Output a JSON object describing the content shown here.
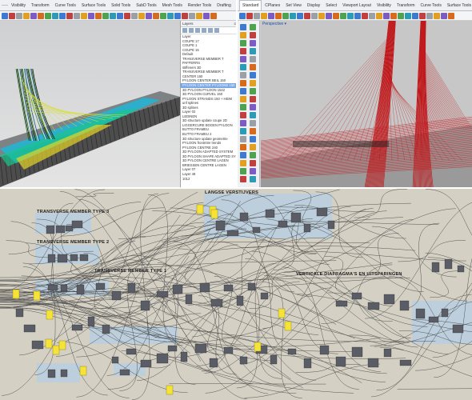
{
  "rhino_left": {
    "tabs": [
      "",
      "Visibility",
      "Transform",
      "Curve Tools",
      "Surface Tools",
      "Solid Tools",
      "SubD Tools",
      "Mesh Tools",
      "Render Tools",
      "Drafting",
      "New in V7"
    ],
    "layer_panel": {
      "title": "Layers",
      "layers": [
        "Layer",
        "COUPE 17",
        "COUPE 1",
        "COUPE 15",
        "Default",
        "TRANSVERSE MEMBER T",
        "PAFFERRS",
        "stiffeners 3D",
        "TRANSVERSE MEMBER T",
        "CENTER 150",
        "PYLOON CENTER BEIL 150",
        "PYLOON CENTER PYLOONE 150",
        "3D PYLOON PYLOON 1542",
        "3D PYLOON CURVEL 150",
        "PYLOON STRANDS 150 + HEIM",
        "unf splines",
        "3D splines",
        "Layer 02",
        "LEDINEN",
        "3D structure update coupe 2D",
        "LIGGERCURE BOGEN PYLOON",
        "BUTTO FRAMEU",
        "BUTTO FRAMEU 2",
        "3D structure update geometrie",
        "PYLOON frontmtre trends",
        "PYLOON CENTRE 240",
        "3D PYLOON ADAPTED SYSTEM",
        "3D PYLOON SHAPE ADAPTED SYSTEM",
        "3D PYLOON CENTRE LAGEN",
        "BRIESSEN CENTRE LAGEN",
        "Layer 07",
        "Layer 48",
        "1012"
      ],
      "selected_index": 11
    }
  },
  "rhino_right": {
    "tabs": [
      "Standard",
      "CPlanes",
      "Set View",
      "Display",
      "Select",
      "Viewport Layout",
      "Visibility",
      "Transform",
      "Curve Tools",
      "Surface Tools",
      "Solid Tools",
      "SubD Tools",
      "Mesh Tools"
    ],
    "viewport_title": "Perspective ▾"
  },
  "grasshopper": {
    "group_labels": {
      "g1": "LANGSE VERSTIJVERS",
      "g2": "TRANSVERSE MEMBER TYPE 3",
      "g3": "TRANSVERSE MEMBER TYPE 2",
      "g4": "TRANSVERSE MEMBER TYPE 1",
      "g5": "VERTICALE DIAFRAGMA'S EN UITSPARINGEN"
    }
  },
  "colors": {
    "gh_canvas": "#d4d0c4",
    "gh_group": "#b9cfe0",
    "gh_component": "#5a5d66",
    "gh_panel": "#f5e33a",
    "red_geometry": "#c0181b",
    "layer_selected": "#7aa6e6"
  }
}
